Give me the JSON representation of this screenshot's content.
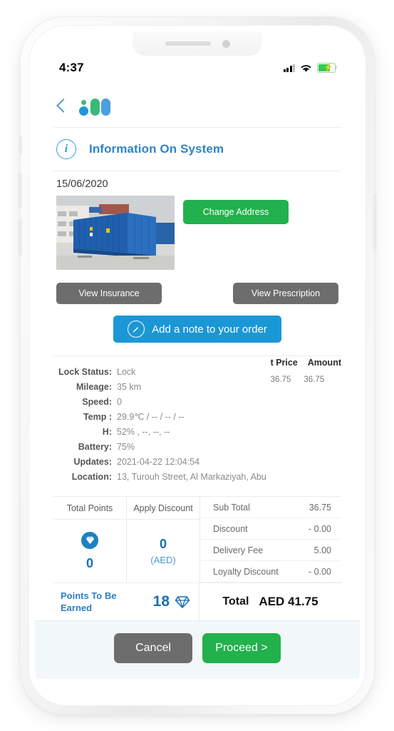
{
  "status_bar": {
    "time": "4:37",
    "signal_icon": "cellular-signal-icon",
    "wifi_icon": "wifi-icon",
    "battery_icon": "battery-charging-icon"
  },
  "nav": {
    "back_icon": "back-chevron-icon",
    "logo_name": "app-logo"
  },
  "header": {
    "icon": "info-circle-icon",
    "title": "Information On System"
  },
  "order": {
    "date": "15/06/2020",
    "photo_name": "blue-shipping-container-photo",
    "change_address_label": "Change Address",
    "view_insurance_label": "View Insurance",
    "view_prescription_label": "View Prescription",
    "note_label": "Add a note to your order",
    "note_icon": "pencil-edit-icon"
  },
  "details": [
    {
      "label": "Lock Status:",
      "value": "Lock"
    },
    {
      "label": "Mileage:",
      "value": "35 km"
    },
    {
      "label": "Speed:",
      "value": "0"
    },
    {
      "label": "Temp :",
      "value": "29.9℃ / -- / -- / --"
    },
    {
      "label": "H:",
      "value": "52% , --, --, --"
    },
    {
      "label": "Battery:",
      "value": "75%"
    },
    {
      "label": "Updates:",
      "value": "2021-04-22 12:04:54"
    },
    {
      "label": "Location:",
      "value": "13, Turouh Street, Al Markaziyah, Abu"
    }
  ],
  "ghost_table": {
    "headers": [
      "t Price",
      "Amount"
    ],
    "values": [
      "36.75",
      "36.75"
    ]
  },
  "points": {
    "total_points_header": "Total Points",
    "apply_discount_header": "Apply Discount",
    "total_points_value": "0",
    "total_points_icon": "diamond-filled-icon",
    "discount_value": "0",
    "discount_currency": "(AED)"
  },
  "summary": {
    "rows": [
      {
        "label": "Sub Total",
        "value": "36.75"
      },
      {
        "label": "Discount",
        "value": "- 0.00"
      },
      {
        "label": "Delivery Fee",
        "value": "5.00"
      },
      {
        "label": "Loyalty Discount",
        "value": "- 0.00"
      }
    ]
  },
  "earned": {
    "label": "Points To Be Earned",
    "value": "18",
    "icon": "diamond-outline-icon"
  },
  "total": {
    "label": "Total",
    "amount": "AED 41.75"
  },
  "actions": {
    "cancel_label": "Cancel",
    "proceed_label": "Proceed >"
  },
  "colors": {
    "brand_blue": "#2f84c8",
    "brand_green": "#22b14c",
    "note_blue": "#1b97d5",
    "gray_button": "#6d6d6d",
    "points_blue": "#1b6fb0",
    "action_bar_bg": "#f2f7fa"
  }
}
